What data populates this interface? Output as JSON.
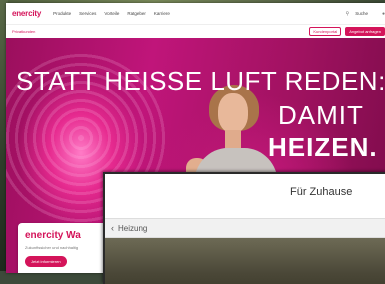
{
  "site": {
    "logo": "enercity",
    "nav": [
      "Produkte",
      "Services",
      "Vorteile",
      "Ratgeber",
      "Karriere"
    ],
    "nav_right": "Suche",
    "breadcrumb": "Privatkunden",
    "sub_outline_button": "Kundenportal",
    "sub_fill_button": "Angebot anfragen"
  },
  "hero": {
    "line1": "STATT HEISSE LUFT REDEN:",
    "line2": "DAMIT",
    "line3": "HEIZEN."
  },
  "card": {
    "title": "enercity Wa",
    "text": "Zukunftssicher und nachhaltig",
    "button": "Jetzt informieren"
  },
  "window2": {
    "title": "Für Zuhause",
    "section": "Heizung"
  },
  "colors": {
    "brand": "#d4145a",
    "hero": "#b5136f"
  }
}
